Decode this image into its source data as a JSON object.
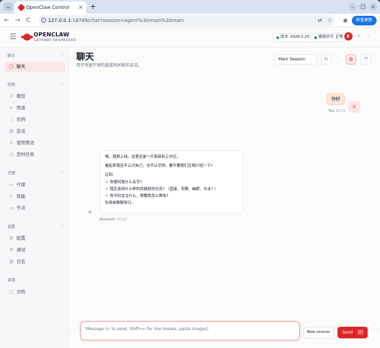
{
  "browser": {
    "tab_title": "OpenClaw Control",
    "tab_close": "×",
    "new_tab": "+",
    "menu_icon": "⌄",
    "url_host": "127.0.0.1",
    "url_rest": ":18789/chat?session=agent%3Amain%3Amain",
    "profile_label": "检查更新",
    "back": "←",
    "forward": "→",
    "reload": "C",
    "translate_icon": "⇄",
    "star_icon": "☆",
    "account_icon": "◉",
    "window_minimize": "–",
    "window_maximize": "□",
    "window_close": "×"
  },
  "header": {
    "brand": "OPENCLAW",
    "brand_sub": "GATEWAY DASHBOARD",
    "version_label": "版本",
    "version_value": "2026.2.25",
    "health_label": "健康状况",
    "health_value": "正常",
    "status_color": "#16a34a",
    "accent": "#dc2626"
  },
  "sidebar": {
    "sections": [
      {
        "title": "聊天",
        "items": [
          {
            "label": "聊天",
            "icon": "chat-icon",
            "active": true
          }
        ]
      },
      {
        "title": "控制",
        "items": [
          {
            "label": "概览",
            "icon": "bar-chart-icon"
          },
          {
            "label": "频道",
            "icon": "link-icon"
          },
          {
            "label": "实例",
            "icon": "radio-icon"
          },
          {
            "label": "会话",
            "icon": "document-icon"
          },
          {
            "label": "使用情况",
            "icon": "bar-chart-icon"
          },
          {
            "label": "定时任务",
            "icon": "clock-icon"
          }
        ]
      },
      {
        "title": "代理",
        "items": [
          {
            "label": "代理",
            "icon": "folder-icon"
          },
          {
            "label": "技能",
            "icon": "sparkle-icon"
          },
          {
            "label": "节点",
            "icon": "monitor-icon"
          }
        ]
      },
      {
        "title": "设置",
        "items": [
          {
            "label": "配置",
            "icon": "gear-icon"
          },
          {
            "label": "调试",
            "icon": "bug-icon"
          },
          {
            "label": "日志",
            "icon": "log-icon"
          }
        ]
      },
      {
        "title": "资源",
        "items": [
          {
            "label": "文档",
            "icon": "book-icon"
          }
        ]
      }
    ],
    "collapse_symbol": "−"
  },
  "main": {
    "title": "聊天",
    "subtitle": "用于快速干预的直接网关聊天会话。",
    "session_select": "Main Session",
    "messages": [
      {
        "role": "user",
        "text": "你好",
        "sender": "You",
        "time": "20:12",
        "avatar": "U"
      },
      {
        "role": "assistant",
        "sender": "Assistant",
        "time": "20:13",
        "avatar": "A",
        "intro": "嘿，我刚上线。这里还是一片崭新的工作区。",
        "line2": "看起来我还不认识自己，也不认识你。要不要我们互相介绍一下?",
        "line3": "比如:",
        "bullets": [
          "你想叫我什么名字?",
          "我应该用什么样的风格和你交流? （直接、安静、幽默、专业? ）",
          "你平时关注什么，想要我怎么帮你?"
        ],
        "closing": "先简单聊聊就行。"
      }
    ],
    "composer": {
      "placeholder": "Message (↩ to send, Shift+↩ for line breaks, paste images)",
      "new_session": "New session",
      "send": "Send",
      "send_kbd": "↩"
    }
  }
}
